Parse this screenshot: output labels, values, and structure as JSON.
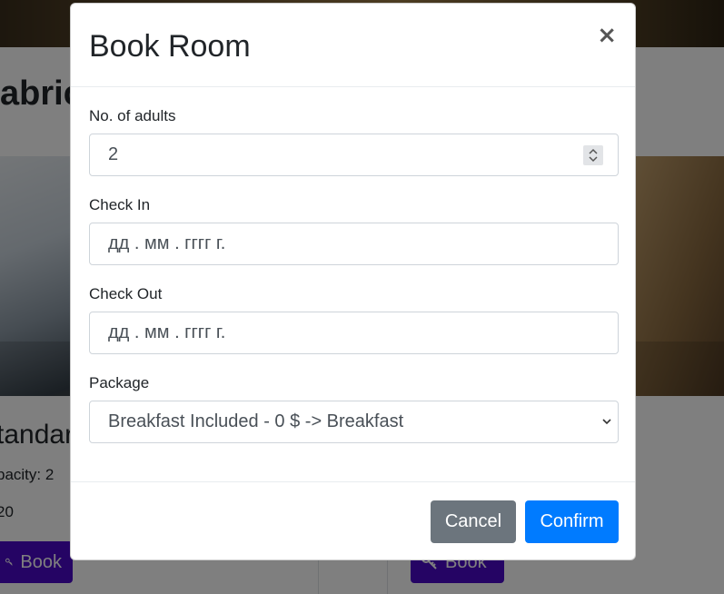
{
  "background": {
    "hotel_title": "abric",
    "room_name": "tandar",
    "room_capacity": "pacity: 2",
    "room_price": "20",
    "book_label": "Book"
  },
  "modal": {
    "title": "Book Room",
    "close_label": "×",
    "adults": {
      "label": "No. of adults",
      "value": "2"
    },
    "check_in": {
      "label": "Check In",
      "placeholder": "дд . мм . гггг  г."
    },
    "check_out": {
      "label": "Check Out",
      "placeholder": "дд . мм . гггг  г."
    },
    "package": {
      "label": "Package",
      "selected": "Breakfast Included - 0 $ -> Breakfast"
    },
    "cancel_label": "Cancel",
    "confirm_label": "Confirm"
  },
  "colors": {
    "primary": "#007bff",
    "secondary": "#6c757d",
    "book_button": "#4b08c8"
  }
}
